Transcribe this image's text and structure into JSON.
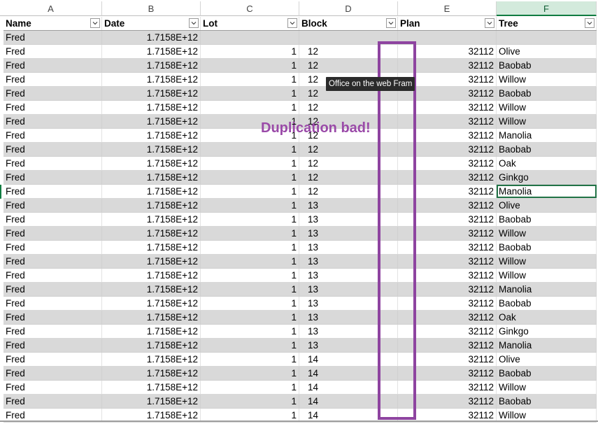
{
  "columns": [
    "A",
    "B",
    "C",
    "D",
    "E",
    "F"
  ],
  "selected_column": "F",
  "headers": [
    "Name",
    "Date",
    "Lot",
    "Block",
    "Plan",
    "Tree"
  ],
  "rows": [
    [
      "Fred",
      "1.7158E+12",
      "",
      "",
      "",
      ""
    ],
    [
      "Fred",
      "1.7158E+12",
      "1",
      "12",
      "32112",
      "Olive"
    ],
    [
      "Fred",
      "1.7158E+12",
      "1",
      "12",
      "32112",
      "Baobab"
    ],
    [
      "Fred",
      "1.7158E+12",
      "1",
      "12",
      "32112",
      "Willow"
    ],
    [
      "Fred",
      "1.7158E+12",
      "1",
      "12",
      "32112",
      "Baobab"
    ],
    [
      "Fred",
      "1.7158E+12",
      "1",
      "12",
      "32112",
      "Willow"
    ],
    [
      "Fred",
      "1.7158E+12",
      "1",
      "12",
      "32112",
      "Willow"
    ],
    [
      "Fred",
      "1.7158E+12",
      "1",
      "12",
      "32112",
      "Manolia"
    ],
    [
      "Fred",
      "1.7158E+12",
      "1",
      "12",
      "32112",
      "Baobab"
    ],
    [
      "Fred",
      "1.7158E+12",
      "1",
      "12",
      "32112",
      "Oak"
    ],
    [
      "Fred",
      "1.7158E+12",
      "1",
      "12",
      "32112",
      "Ginkgo"
    ],
    [
      "Fred",
      "1.7158E+12",
      "1",
      "12",
      "32112",
      "Manolia"
    ],
    [
      "Fred",
      "1.7158E+12",
      "1",
      "13",
      "32112",
      "Olive"
    ],
    [
      "Fred",
      "1.7158E+12",
      "1",
      "13",
      "32112",
      "Baobab"
    ],
    [
      "Fred",
      "1.7158E+12",
      "1",
      "13",
      "32112",
      "Willow"
    ],
    [
      "Fred",
      "1.7158E+12",
      "1",
      "13",
      "32112",
      "Baobab"
    ],
    [
      "Fred",
      "1.7158E+12",
      "1",
      "13",
      "32112",
      "Willow"
    ],
    [
      "Fred",
      "1.7158E+12",
      "1",
      "13",
      "32112",
      "Willow"
    ],
    [
      "Fred",
      "1.7158E+12",
      "1",
      "13",
      "32112",
      "Manolia"
    ],
    [
      "Fred",
      "1.7158E+12",
      "1",
      "13",
      "32112",
      "Baobab"
    ],
    [
      "Fred",
      "1.7158E+12",
      "1",
      "13",
      "32112",
      "Oak"
    ],
    [
      "Fred",
      "1.7158E+12",
      "1",
      "13",
      "32112",
      "Ginkgo"
    ],
    [
      "Fred",
      "1.7158E+12",
      "1",
      "13",
      "32112",
      "Manolia"
    ],
    [
      "Fred",
      "1.7158E+12",
      "1",
      "14",
      "32112",
      "Olive"
    ],
    [
      "Fred",
      "1.7158E+12",
      "1",
      "14",
      "32112",
      "Baobab"
    ],
    [
      "Fred",
      "1.7158E+12",
      "1",
      "14",
      "32112",
      "Willow"
    ],
    [
      "Fred",
      "1.7158E+12",
      "1",
      "14",
      "32112",
      "Baobab"
    ],
    [
      "Fred",
      "1.7158E+12",
      "1",
      "14",
      "32112",
      "Willow"
    ]
  ],
  "active_row_index": 11,
  "annotation_text": "Duplication bad!",
  "tooltip_text": "Office on the web Fram",
  "colors": {
    "band": "#d9d9d9",
    "annotation": "#8e44a0",
    "selection": "#107c41"
  }
}
